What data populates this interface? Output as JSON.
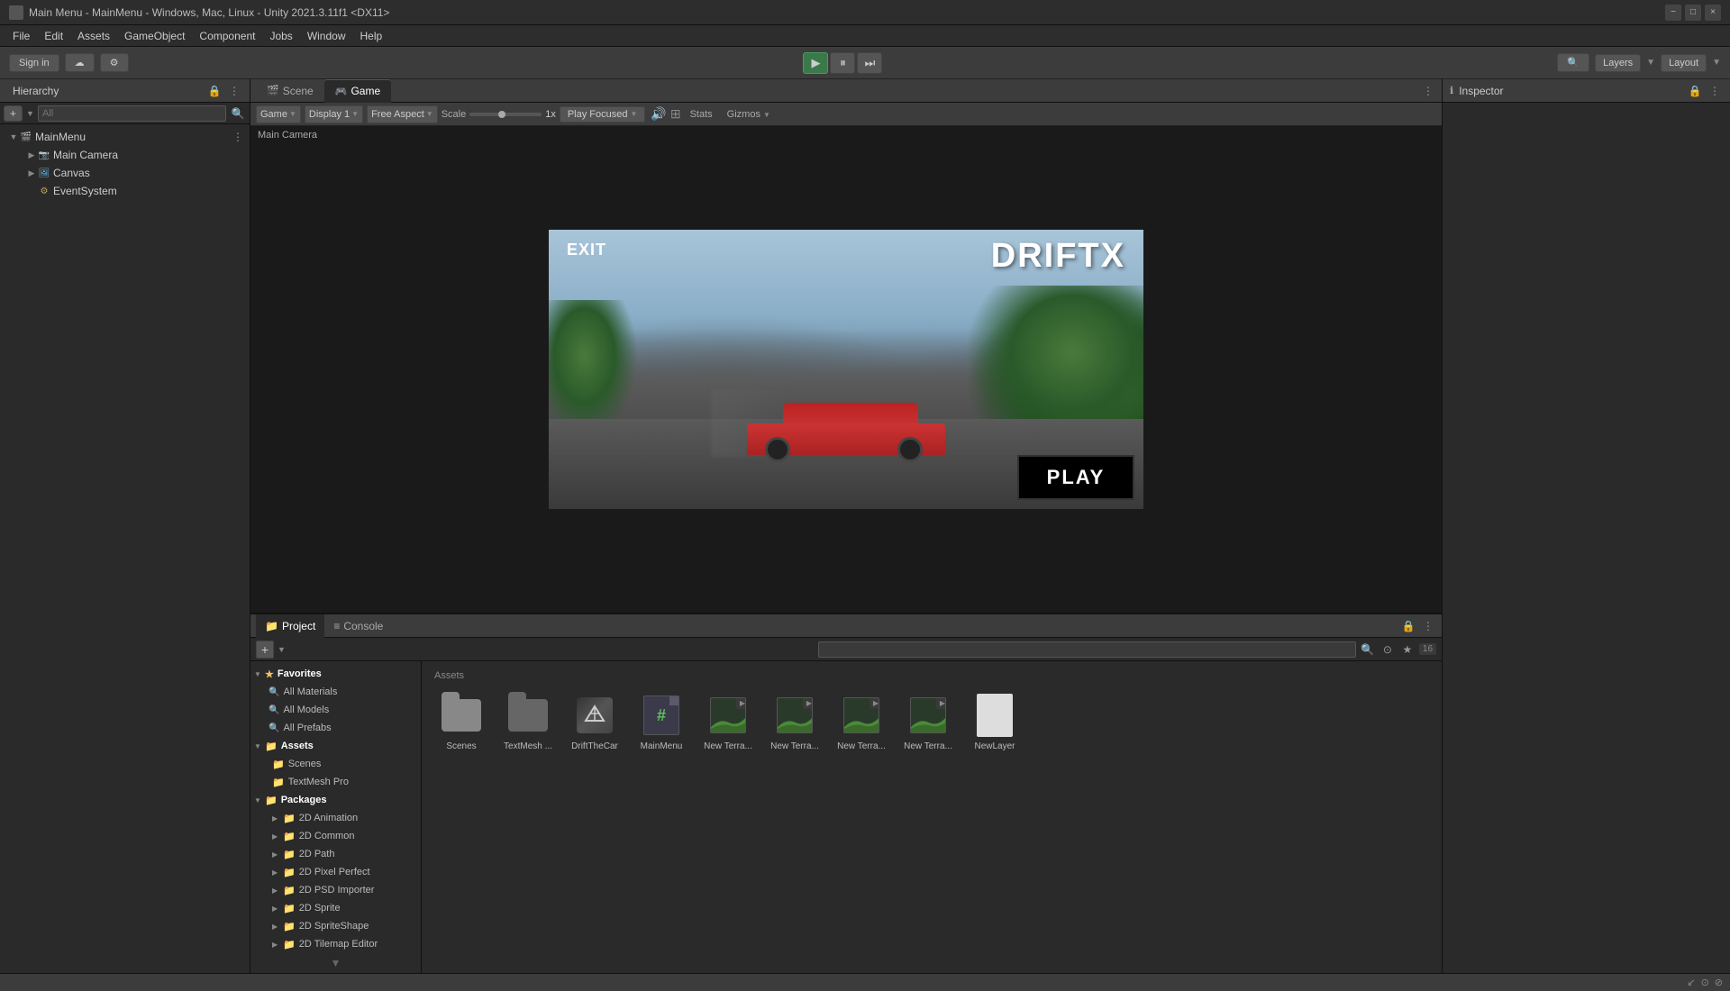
{
  "titleBar": {
    "title": "Main Menu - MainMenu - Windows, Mac, Linux - Unity 2021.3.11f1 <DX11>",
    "closeLabel": "×",
    "minimizeLabel": "−",
    "maximizeLabel": "□"
  },
  "menuBar": {
    "items": [
      "File",
      "Edit",
      "Assets",
      "GameObject",
      "Component",
      "Jobs",
      "Window",
      "Help"
    ]
  },
  "toolbar": {
    "signInLabel": "Sign in",
    "colabLabel": "☁",
    "layersLabel": "Layers",
    "layoutLabel": "Layout"
  },
  "hierarchy": {
    "panelTitle": "Hierarchy",
    "searchPlaceholder": "All",
    "addButtonLabel": "+",
    "tree": [
      {
        "name": "MainMenu",
        "type": "scene",
        "level": 0,
        "expanded": true
      },
      {
        "name": "Main Camera",
        "type": "camera",
        "level": 1,
        "expanded": false
      },
      {
        "name": "Canvas",
        "type": "canvas",
        "level": 1,
        "expanded": false
      },
      {
        "name": "EventSystem",
        "type": "eventsystem",
        "level": 1,
        "expanded": false
      }
    ]
  },
  "gameView": {
    "tabs": [
      {
        "label": "Scene",
        "icon": "🎬",
        "active": false
      },
      {
        "label": "Game",
        "icon": "🎮",
        "active": true
      }
    ],
    "toolbar": {
      "gameLabel": "Game",
      "display": "Display 1",
      "aspect": "Free Aspect",
      "scaleLabel": "Scale",
      "scaleValue": "1x",
      "playFocused": "Play Focused",
      "statsLabel": "Stats",
      "gizmosLabel": "Gizmos"
    },
    "scene": {
      "exitLabel": "EXIT",
      "titleLabel": "DRIFTX",
      "playLabel": "PLAY",
      "cameraLabel": "Main Camera"
    }
  },
  "inspector": {
    "title": "Inspector",
    "icon": "ℹ"
  },
  "project": {
    "tabs": [
      {
        "label": "Project",
        "icon": "📁",
        "active": true
      },
      {
        "label": "Console",
        "icon": "≡",
        "active": false
      }
    ],
    "addLabel": "+",
    "searchPlaceholder": "",
    "assetsLabel": "Assets",
    "badge": "16",
    "sidebar": {
      "sections": [
        {
          "label": "Favorites",
          "expanded": true,
          "items": [
            {
              "label": "All Materials"
            },
            {
              "label": "All Models"
            },
            {
              "label": "All Prefabs"
            }
          ]
        },
        {
          "label": "Assets",
          "expanded": true,
          "items": [
            {
              "label": "Scenes"
            },
            {
              "label": "TextMesh Pro"
            }
          ]
        },
        {
          "label": "Packages",
          "expanded": true,
          "items": [
            {
              "label": "2D Animation"
            },
            {
              "label": "2D Common"
            },
            {
              "label": "2D Path"
            },
            {
              "label": "2D Pixel Perfect"
            },
            {
              "label": "2D PSD Importer"
            },
            {
              "label": "2D Sprite"
            },
            {
              "label": "2D SpriteShape"
            },
            {
              "label": "2D Tilemap Editor"
            }
          ]
        }
      ]
    },
    "assets": [
      {
        "label": "Scenes",
        "type": "folder-dark"
      },
      {
        "label": "TextMesh ...",
        "type": "folder-dark"
      },
      {
        "label": "DriftTheCar",
        "type": "unity-cube"
      },
      {
        "label": "MainMenu",
        "type": "csharp"
      },
      {
        "label": "New Terra...",
        "type": "terrain"
      },
      {
        "label": "New Terra...",
        "type": "terrain"
      },
      {
        "label": "New Terra...",
        "type": "terrain"
      },
      {
        "label": "New Terra...",
        "type": "terrain"
      },
      {
        "label": "NewLayer",
        "type": "page"
      }
    ]
  },
  "bottomBar": {
    "icons": [
      "↙",
      "⊙",
      "⊘"
    ]
  }
}
